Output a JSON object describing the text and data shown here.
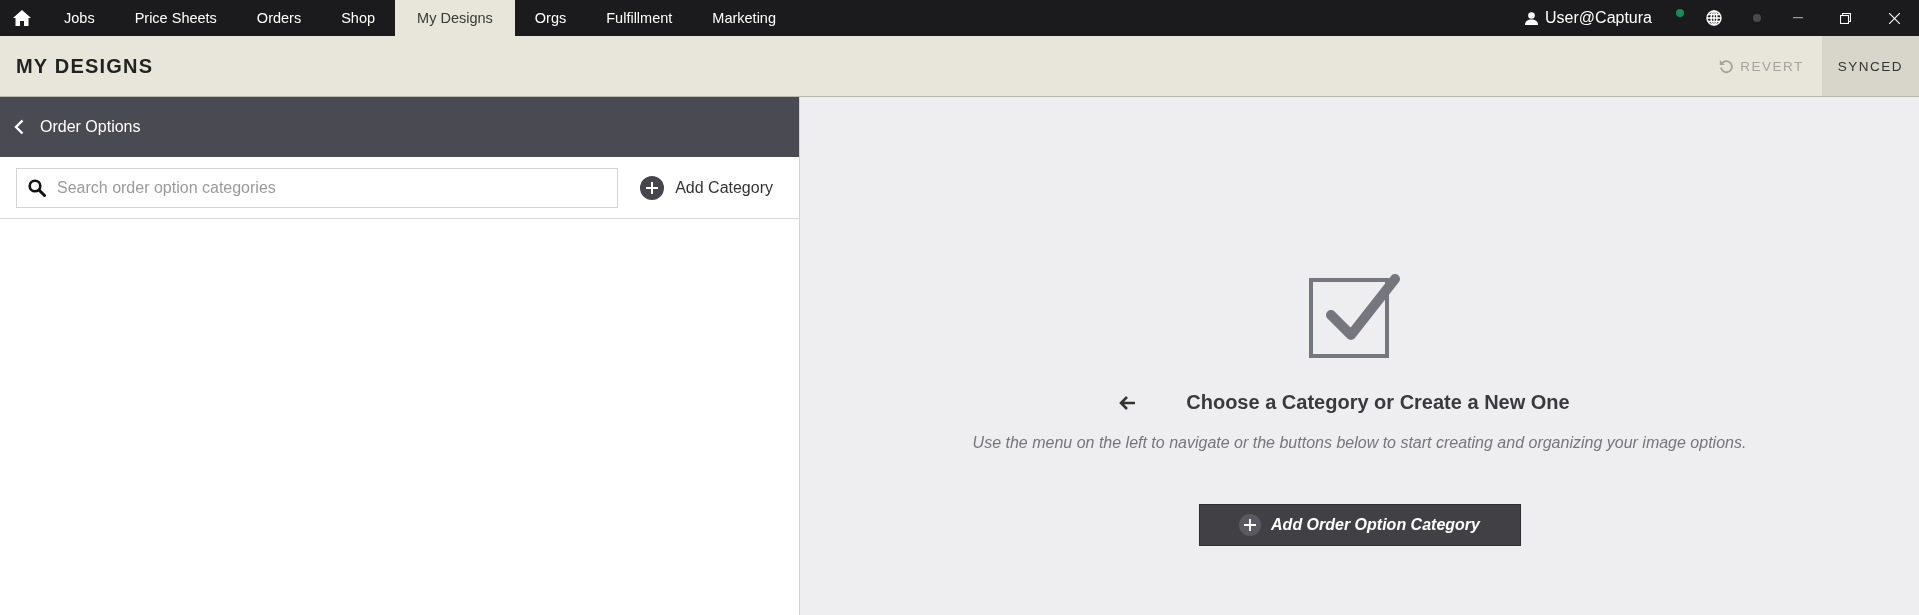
{
  "nav": {
    "tabs": [
      {
        "label": "Jobs",
        "selected": false
      },
      {
        "label": "Price Sheets",
        "selected": false
      },
      {
        "label": "Orders",
        "selected": false
      },
      {
        "label": "Shop",
        "selected": false
      },
      {
        "label": "My Designs",
        "selected": true
      },
      {
        "label": "Orgs",
        "selected": false
      },
      {
        "label": "Fulfillment",
        "selected": false
      },
      {
        "label": "Marketing",
        "selected": false
      }
    ],
    "user": "User@Captura"
  },
  "header": {
    "title": "MY DESIGNS",
    "revert": {
      "label": "REVERT",
      "disabled": true
    },
    "sync_status": "SYNCED"
  },
  "panel": {
    "title": "Order Options",
    "search": {
      "placeholder": "Search order option categories"
    },
    "add_button": "Add Category"
  },
  "empty_state": {
    "heading": "Choose a Category or Create a New One",
    "description": "Use the menu on the left to navigate or the buttons below to start creating and organizing your image options.",
    "button": "Add Order Option Category"
  }
}
